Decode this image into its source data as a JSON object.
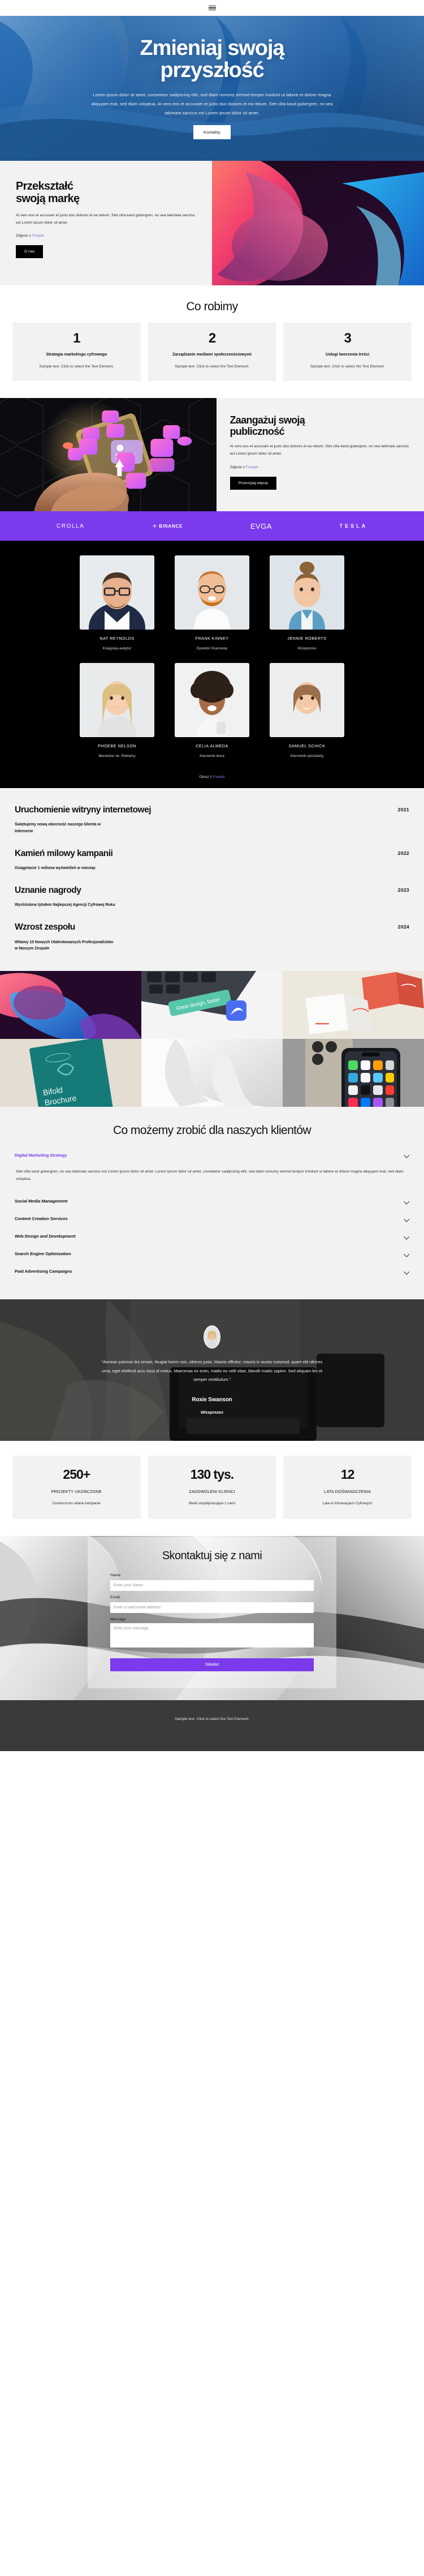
{
  "nav": {
    "menu_icon": "hamburger-menu-icon"
  },
  "hero": {
    "title_line1": "Zmieniaj swoją",
    "title_line2": "przyszłość",
    "paragraph": "Lorem ipsum dolor sit amet, consetetur sadipscing elitr, sed diam nonumy eirmod tempor invidunt ut labore et dolore magna aliquyam erat, sed diam voluptua. At vero eos et accusam et justo duo dolores et ea rebum. Stet clita kasd gubergren, no sea takimata sanctus est Lorem ipsum dolor sit amet.",
    "cta": "Kontakty"
  },
  "brand": {
    "title_line1": "Przekształć",
    "title_line2": "swoją markę",
    "paragraph": "At vero eos et accusam et justo duo dolores et ea rebum. Stet clita kasd gubergren, no sea takimata sanctus est Lorem ipsum dolor sit amet.",
    "credit_prefix": "Zdjęcie z ",
    "credit_link": "Freepik",
    "cta": "O nas"
  },
  "services": {
    "heading": "Co robimy",
    "items": [
      {
        "num": "1",
        "title": "Strategia marketingu cyfrowego",
        "desc": "Sample text. Click to select the Text Element."
      },
      {
        "num": "2",
        "title": "Zarządzanie mediami społecznościowymi",
        "desc": "Sample text. Click to select the Text Element."
      },
      {
        "num": "3",
        "title": "Usługi tworzenia treści",
        "desc": "Sample text. Click to select the Text Element."
      }
    ]
  },
  "engage": {
    "title_line1": "Zaangażuj swoją",
    "title_line2": "publiczność",
    "paragraph": "At vero eos et accusam et justo duo dolores et ea rebum. Stet clita kasd gubergren, no sea takimata sanctus est Lorem ipsum dolor sit amet.",
    "credit_prefix": "Zdjęcie z ",
    "credit_link": "Freepik",
    "cta": "Przeczytaj więcej"
  },
  "logos": {
    "accent": "#7c3aed",
    "items": [
      {
        "name": "CROLLA",
        "icon": "crolla-logo"
      },
      {
        "name": "BINANCE",
        "icon": "binance-logo"
      },
      {
        "name": "EVGA",
        "icon": "evga-logo"
      },
      {
        "name": "TESLA",
        "icon": "tesla-logo"
      }
    ]
  },
  "team": {
    "members": [
      {
        "name": "NAT REYNOLDS",
        "role": "Księgowy-audytor"
      },
      {
        "name": "FRANK KINNEY",
        "role": "Dyrektor finansowy"
      },
      {
        "name": "JENNIE ROBERTS",
        "role": "Wiceprezes"
      },
      {
        "name": "PHOEBE NELSON",
        "role": "Menedżer ds. Reklamy"
      },
      {
        "name": "CELIA ALMEDA",
        "role": "Kierownik biura"
      },
      {
        "name": "SAMUEL SCHICK",
        "role": "Kierownik sprzedaży"
      }
    ],
    "credit_prefix": "Obraz z ",
    "credit_link": "Freepik"
  },
  "timeline": [
    {
      "title": "Uruchomienie witryny internetowej",
      "desc": "Świętujemy nową obecność naszego klienta w Internecie",
      "year": "2021"
    },
    {
      "title": "Kamień milowy kampanii",
      "desc": "Osiągnięcie 1 miliona wyświetleń w miesiąc",
      "year": "2022"
    },
    {
      "title": "Uznanie nagrody",
      "desc": "Wyróżniona tytułem Najlepszej Agencji Cyfrowej Roku",
      "year": "2023"
    },
    {
      "title": "Wzrost zespołu",
      "desc": "Witamy 10 Nowych Utalentowanych Profesjonalistów w Naszym Zespole",
      "year": "2024"
    }
  ],
  "gallery": [
    {
      "alt": "abstract-pink-blue-swirl"
    },
    {
      "alt": "laptop-sticker-great-design-faster"
    },
    {
      "alt": "a7-greeting-card-mockup"
    },
    {
      "alt": "bifold-brochure-mockup"
    },
    {
      "alt": "white-abstract-wave"
    },
    {
      "alt": "iphone-pro-mockup"
    }
  ],
  "faq": {
    "heading": "Co możemy zrobić dla naszych klientów",
    "open_item": {
      "title": "Digital Marketing Strategy",
      "body": "Stet clita kasd gubergren, no sea takimata sanctus est Lorem ipsum dolor sit amet. Lorem ipsum dolor sit amet, consetetur sadipscing elitr, sed diam nonumy eirmod tempor invidunt ut labore et dolore magna aliquyam erat, sed diam voluptua.",
      "accent": "#7c3aed"
    },
    "items": [
      {
        "title": "Social Media Management"
      },
      {
        "title": "Content Creation Services"
      },
      {
        "title": "Web Design and Development"
      },
      {
        "title": "Search Engine Optimization"
      },
      {
        "title": "Paid Advertising Campaigns"
      }
    ],
    "chevron_icon": "chevron-down-icon"
  },
  "testimonial": {
    "quote": "\"Aenean pulvinar dui ornare, feugiat lorem non, ultrices justo. Mauris efficitur, mauris in auctor euismod, quam elit ultrices urna, eget eleifend arcu risus id metus. Maecenas ex enim, mattis eu velit vitae, blandit mattis sapien. Sed aliquam leo et semper vestibulum.\"",
    "author": "Roxie Swanson",
    "role": "Wiceprezes"
  },
  "stats": [
    {
      "value": "250+",
      "label": "PROJEKTY UKOŃCZONE",
      "sub": "Dostarczono udane kampanie"
    },
    {
      "value": "130 tys.",
      "label": "ZADOWOLENI KLIENCI",
      "sub": "Marki współpracujące z nami"
    },
    {
      "value": "12",
      "label": "LATA DOŚWIADCZENIA",
      "sub": "Lata w Innowacjach Cyfrowych"
    }
  ],
  "contact": {
    "heading": "Skontaktuj się z nami",
    "name_label": "Name",
    "name_placeholder": "Enter your Name",
    "email_label": "Email",
    "email_placeholder": "Enter a valid email address",
    "message_label": "Message",
    "message_placeholder": "Enter your message",
    "submit": "Składać",
    "accent": "#7c3aed"
  },
  "footer": {
    "text": "Sample text. Click to select the Text Element."
  }
}
